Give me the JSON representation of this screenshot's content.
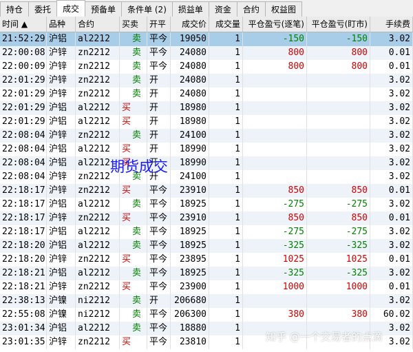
{
  "tabs": [
    "持仓",
    "委托",
    "成交",
    "预备单",
    "条件单 (2)",
    "损益单",
    "资金",
    "合约",
    "权益图"
  ],
  "active_tab": 2,
  "columns": [
    "时间 ▲",
    "品种",
    "合约",
    "买卖",
    "开平",
    "成交价",
    "成交量",
    "平仓盈亏(逐笔)",
    "平仓盈亏(盯市)",
    "手续费"
  ],
  "rows": [
    [
      "21:52:29",
      "沪铝",
      "al2212",
      "卖",
      "平今",
      "19050",
      "1",
      "-150",
      "-150",
      "3.02"
    ],
    [
      "22:00:08",
      "沪锌",
      "zn2212",
      "卖",
      "平今",
      "24080",
      "1",
      "800",
      "800",
      "0.01"
    ],
    [
      "22:00:09",
      "沪锌",
      "zn2212",
      "卖",
      "平今",
      "24080",
      "1",
      "800",
      "800",
      "0.01"
    ],
    [
      "22:01:29",
      "沪锌",
      "zn2212",
      "卖",
      "开",
      "24080",
      "1",
      "",
      "",
      "3.02"
    ],
    [
      "22:01:29",
      "沪锌",
      "zn2212",
      "卖",
      "开",
      "24080",
      "1",
      "",
      "",
      "3.02"
    ],
    [
      "22:01:29",
      "沪铝",
      "al2212",
      "买",
      "开",
      "18980",
      "1",
      "",
      "",
      "3.02"
    ],
    [
      "22:01:29",
      "沪铝",
      "al2212",
      "买",
      "开",
      "18980",
      "1",
      "",
      "",
      "3.02"
    ],
    [
      "22:08:04",
      "沪锌",
      "zn2212",
      "卖",
      "开",
      "24100",
      "1",
      "",
      "",
      "3.02"
    ],
    [
      "22:08:04",
      "沪铝",
      "al2212",
      "买",
      "开",
      "18990",
      "1",
      "",
      "",
      "3.02"
    ],
    [
      "22:08:04",
      "沪铝",
      "al2212",
      "买",
      "开",
      "18990",
      "1",
      "",
      "",
      "3.02"
    ],
    [
      "22:08:04",
      "沪锌",
      "zn2212",
      "卖",
      "开",
      "24100",
      "1",
      "",
      "",
      "3.02"
    ],
    [
      "22:18:17",
      "沪锌",
      "zn2212",
      "买",
      "平今",
      "23910",
      "1",
      "850",
      "850",
      "0.01"
    ],
    [
      "22:18:17",
      "沪铝",
      "al2212",
      "卖",
      "平今",
      "18925",
      "1",
      "-275",
      "-275",
      "3.02"
    ],
    [
      "22:18:17",
      "沪锌",
      "zn2212",
      "买",
      "平今",
      "23910",
      "1",
      "850",
      "850",
      "0.01"
    ],
    [
      "22:18:17",
      "沪铝",
      "al2212",
      "卖",
      "平今",
      "18925",
      "1",
      "-275",
      "-275",
      "3.02"
    ],
    [
      "22:18:20",
      "沪铝",
      "al2212",
      "卖",
      "平今",
      "18925",
      "1",
      "-325",
      "-325",
      "3.02"
    ],
    [
      "22:18:20",
      "沪锌",
      "zn2212",
      "买",
      "平今",
      "23895",
      "1",
      "1025",
      "1025",
      "0.01"
    ],
    [
      "22:18:21",
      "沪铝",
      "al2212",
      "卖",
      "平今",
      "18925",
      "1",
      "-325",
      "-325",
      "3.02"
    ],
    [
      "22:18:21",
      "沪锌",
      "zn2212",
      "买",
      "平今",
      "23900",
      "1",
      "1000",
      "1000",
      "0.01"
    ],
    [
      "22:38:13",
      "沪镍",
      "ni2212",
      "卖",
      "开",
      "206680",
      "1",
      "",
      "",
      "3.02"
    ],
    [
      "22:55:08",
      "沪镍",
      "ni2212",
      "卖",
      "平今",
      "206300",
      "1",
      "380",
      "380",
      "60.02"
    ],
    [
      "23:01:34",
      "沪铝",
      "al2212",
      "卖",
      "平今",
      "18880",
      "1",
      "",
      "",
      "3.02"
    ],
    [
      "23:01:35",
      "沪锌",
      "zn2212",
      "买",
      "平今",
      "23810",
      "1",
      "",
      "",
      "3.02"
    ]
  ],
  "overlay_text": "期货成交",
  "watermark": "知乎 @一个交易者的点滴",
  "colors": {
    "buy": "#d40000",
    "sell": "#008000",
    "selected_row": "#a8cde8"
  }
}
